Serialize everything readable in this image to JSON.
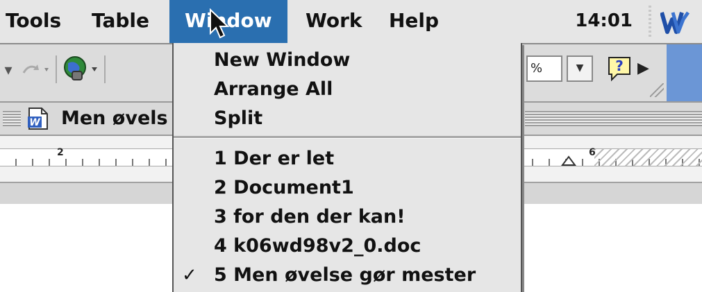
{
  "menubar": {
    "menus": [
      "Tools",
      "Table",
      "Window",
      "Work",
      "Help"
    ],
    "active_menu": "Window",
    "clock": "14:01",
    "app_icon": "word-icon",
    "active_color": "#2a6fb0"
  },
  "toolbar": {
    "zoom_suffix": "%",
    "icons": [
      "undo-icon",
      "redo-icon",
      "hyperlink-globe-icon",
      "help-icon",
      "more-arrow-icon"
    ]
  },
  "document": {
    "title": "Men øvelse gør mester",
    "title_visible": "Men øvels"
  },
  "ruler": {
    "marks": [
      "2",
      "6"
    ]
  },
  "window_menu": {
    "items": [
      {
        "label": "New Window",
        "checked": false
      },
      {
        "label": "Arrange All",
        "checked": false
      },
      {
        "label": "Split",
        "checked": false
      }
    ],
    "documents": [
      {
        "label": "1 Der er let",
        "checked": false
      },
      {
        "label": "2 Document1",
        "checked": false
      },
      {
        "label": "3 for den der kan!",
        "checked": false
      },
      {
        "label": "4 k06wd98v2_0.doc",
        "checked": false
      },
      {
        "label": "5 Men øvelse gør mester",
        "checked": true
      }
    ],
    "check_mark": "✓"
  }
}
